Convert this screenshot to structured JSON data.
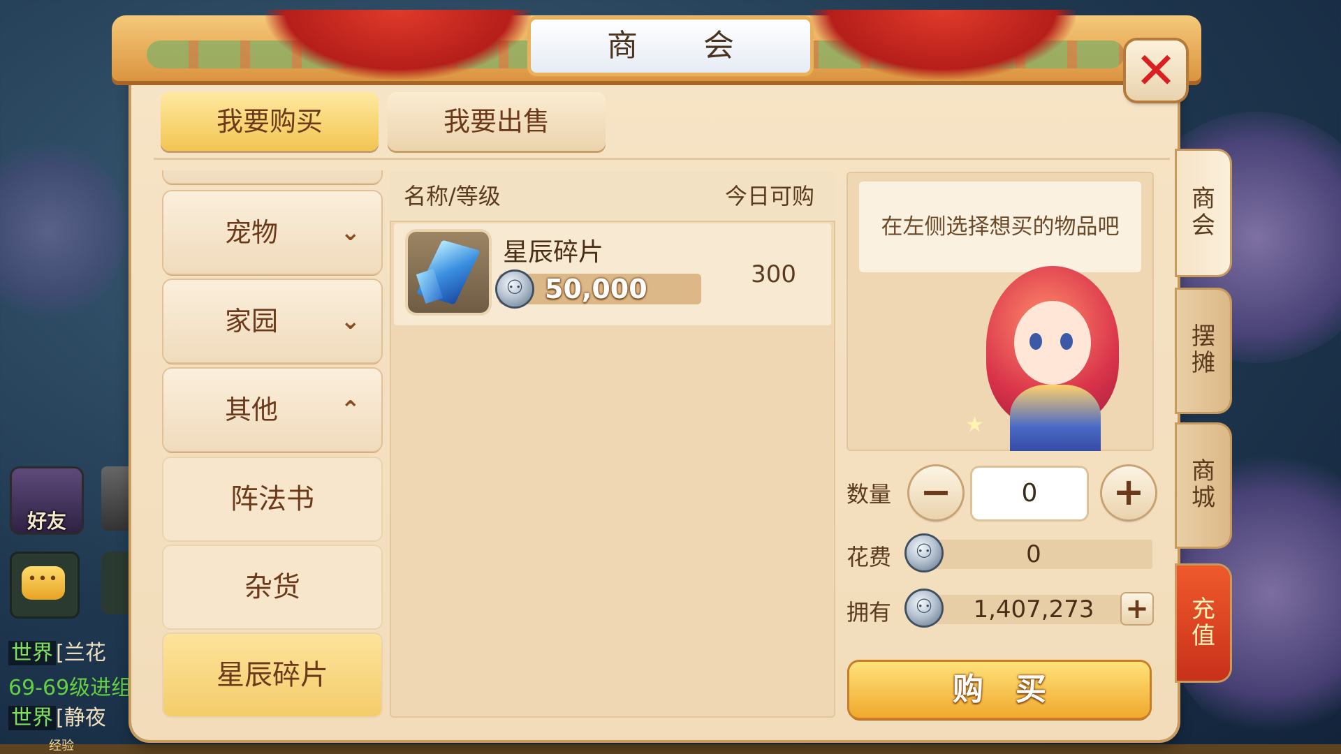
{
  "hud": {
    "friends_label": "好友",
    "chat_lines": [
      {
        "tag": "世界",
        "text": "[兰花"
      },
      {
        "tag": "",
        "text": "69-69级进组"
      },
      {
        "tag": "世界",
        "text": "[静夜"
      }
    ],
    "exp_label": "经验"
  },
  "window": {
    "title": "商 会",
    "close_icon": "close-x-icon"
  },
  "tabs": {
    "buy": "我要购买",
    "sell": "我要出售"
  },
  "categories": [
    {
      "label": "宠物",
      "arrow": "⌄"
    },
    {
      "label": "家园",
      "arrow": "⌄"
    },
    {
      "label": "其他",
      "arrow": "⌃"
    }
  ],
  "subcategories": [
    {
      "label": "阵法书",
      "selected": false
    },
    {
      "label": "杂货",
      "selected": false
    },
    {
      "label": "星辰碎片",
      "selected": true
    }
  ],
  "item_list": {
    "header_name": "名称/等级",
    "header_today": "今日可购",
    "items": [
      {
        "name": "星辰碎片",
        "price": "50,000",
        "count": "300",
        "icon": "crystal-shard-icon"
      }
    ]
  },
  "info": {
    "hint": "在左侧选择想买的物品吧",
    "qty_label": "数量",
    "qty_value": "0",
    "cost_label": "花费",
    "cost_value": "0",
    "own_label": "拥有",
    "own_value": "1,407,273",
    "buy_label": "购买"
  },
  "side_tabs": [
    {
      "label": "商会",
      "active": true
    },
    {
      "label": "摆摊",
      "active": false
    },
    {
      "label": "商城",
      "active": false
    },
    {
      "label": "充值",
      "active": false
    }
  ],
  "colors": {
    "accent_gold": "#f2c552",
    "panel_bg": "#f6e4c6",
    "close_red": "#d91f1f",
    "recharge_red": "#c8311a"
  }
}
